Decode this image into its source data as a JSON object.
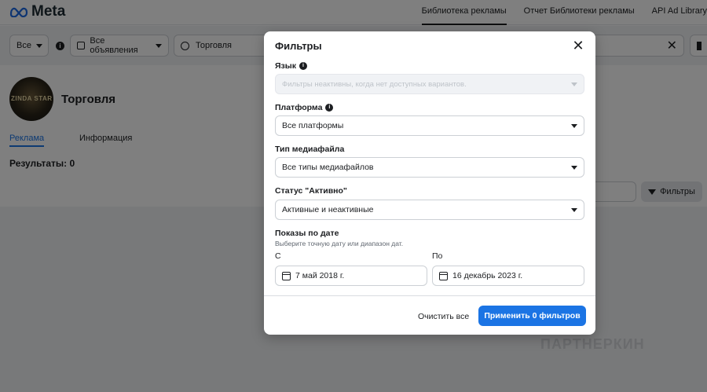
{
  "header": {
    "logo_text": "Meta",
    "nav": [
      "Библиотека рекламы",
      "Отчет Библиотеки рекламы",
      "API Ad Library"
    ]
  },
  "filterbar": {
    "country": "Все",
    "ad_category": "Все объявления",
    "search_value": "Торговля"
  },
  "page": {
    "name": "Торговля",
    "avatar_text": "ZINDA STAR",
    "tabs": [
      "Реклама",
      "Информация"
    ],
    "results": "Результаты: 0",
    "filters_button": "Фильтры",
    "watermark": "ПАРТНЕРКИН"
  },
  "modal": {
    "title": "Фильтры",
    "language_label": "Язык",
    "language_value": "Фильтры неактивны, когда нет доступных вариантов.",
    "platform_label": "Платформа",
    "platform_value": "Все платформы",
    "media_label": "Тип медиафайла",
    "media_value": "Все типы медиафайлов",
    "status_label": "Статус \"Активно\"",
    "status_value": "Активные и неактивные",
    "dates_label": "Показы по дате",
    "dates_hint": "Выберите точную дату или диапазон дат.",
    "from_label": "С",
    "from_value": "7 май 2018 г.",
    "to_label": "По",
    "to_value": "16 декабрь 2023 г.",
    "clear_label": "Очистить все",
    "apply_label": "Применить 0 фильтров"
  }
}
